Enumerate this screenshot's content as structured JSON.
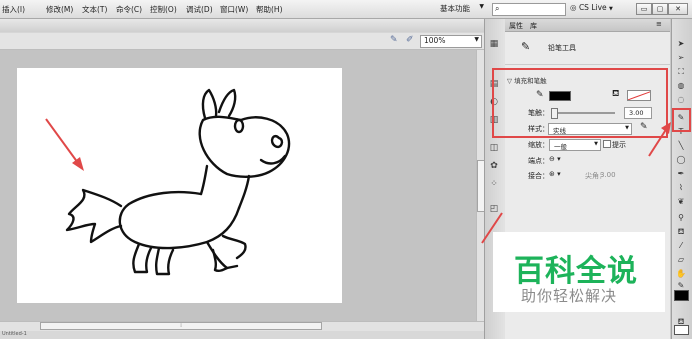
{
  "menu": [
    "插入(I)",
    "修改(M)",
    "文本(T)",
    "命令(C)",
    "控制(O)",
    "调试(D)",
    "窗口(W)",
    "帮助(H)"
  ],
  "workspace": "基本功能",
  "search": {
    "placeholder": "",
    "value": ""
  },
  "cs_live": "CS Live",
  "window_buttons": [
    "▭",
    "▢",
    "✕"
  ],
  "zoom": "100%",
  "status_text": "Untitled-1",
  "panel": {
    "tabs": [
      "属性",
      "库"
    ],
    "menu_glyph": "≡",
    "tool_name": "铅笔工具",
    "section_title": "▽ 填充和笔触",
    "stroke_label": "笔触：",
    "stroke_value": "3.00",
    "style_label": "样式：",
    "style_value": "实线",
    "scale_label": "缩放：",
    "scale_value": "一般",
    "hint_label": "提示",
    "cap_label": "端点：",
    "cap_value": "⊖ ▾",
    "join_label": "接合：",
    "join_value": "⊛ ▾",
    "miter_label": "尖角：",
    "miter_value": "3.00"
  },
  "colors": {
    "highlight": "#e04848",
    "watermark_green": "#1db35a",
    "stroke_color": "#000000",
    "fill_color": "#ffffff"
  },
  "watermark": {
    "title": "百科全说",
    "subtitle": "助你轻松解决"
  },
  "icons": {
    "dock": [
      "library-icon",
      "swatches-icon",
      "align-icon",
      "color-icon",
      "history-icon",
      "components-icon",
      "motion-icon",
      "transform-icon"
    ],
    "tools": [
      "selection-icon",
      "subselection-icon",
      "free-transform-icon",
      "3d-rotation-icon",
      "lasso-icon",
      "pen-icon",
      "text-icon",
      "line-icon",
      "rectangle-icon",
      "pencil-icon",
      "brush-icon",
      "deco-icon",
      "bone-icon",
      "paint-bucket-icon",
      "eyedropper-icon",
      "eraser-icon",
      "hand-icon",
      "zoom-icon"
    ]
  }
}
